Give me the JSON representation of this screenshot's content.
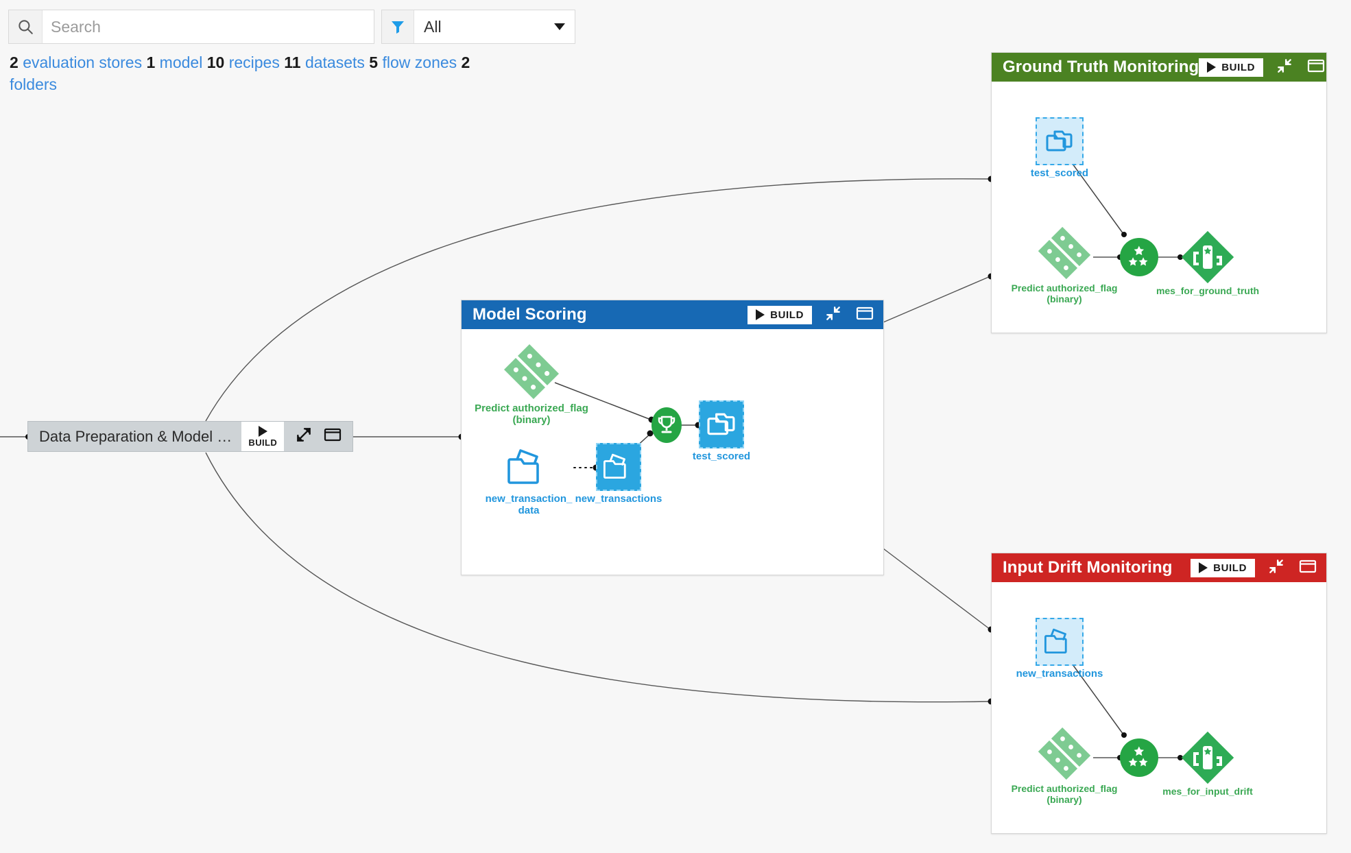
{
  "search": {
    "placeholder": "Search",
    "value": ""
  },
  "filter": {
    "value": "All",
    "icon": "filter-icon"
  },
  "summary": {
    "parts": [
      {
        "text": "2",
        "bold": true
      },
      {
        "text": "evaluation stores",
        "link": true
      },
      {
        "text": "1",
        "bold": true
      },
      {
        "text": "model",
        "link": true
      },
      {
        "text": "10",
        "bold": true
      },
      {
        "text": "recipes",
        "link": true
      },
      {
        "text": "11",
        "bold": true
      },
      {
        "text": "datasets",
        "link": true
      },
      {
        "text": "5",
        "bold": true
      },
      {
        "text": "flow zones",
        "link": true
      },
      {
        "text": "2",
        "bold": true
      },
      {
        "text": "folders",
        "link": true
      }
    ]
  },
  "zone_collapsed": {
    "name": "Data Preparation & Model …",
    "build_label": "BUILD",
    "icons": [
      "expand-icon",
      "window-icon"
    ]
  },
  "panels": [
    {
      "id": "ground-truth-monitoring",
      "title": "Ground Truth Monitoring",
      "color": "#4b8222",
      "build_label": "BUILD",
      "icons": [
        "collapse-icon",
        "window-icon"
      ],
      "nodes": [
        {
          "name": "test_scored",
          "type": "dataset-folder-managed",
          "label": "test_scored",
          "color": "#2196dd"
        },
        {
          "name": "Predict authorized_flag (binary)",
          "type": "model",
          "label": "Predict authorized_flag\n(binary)",
          "color": "#3aa853"
        },
        {
          "name": "scoring-recipe",
          "type": "recipe-stars",
          "label": "",
          "color": "#25a544"
        },
        {
          "name": "mes_for_ground_truth",
          "type": "evaluation-store",
          "label": "mes_for_ground_truth",
          "color": "#3aa853"
        }
      ]
    },
    {
      "id": "model-scoring",
      "title": "Model Scoring",
      "color": "#1769b4",
      "build_label": "BUILD",
      "icons": [
        "collapse-icon",
        "window-icon"
      ],
      "nodes": [
        {
          "name": "Predict authorized_flag (binary)",
          "type": "model",
          "label": "Predict authorized_flag\n(binary)",
          "color": "#3aa853"
        },
        {
          "name": "new_transaction_data",
          "type": "folder-outline",
          "label": "new_transaction_\ndata",
          "color": "#2196dd"
        },
        {
          "name": "new_transactions",
          "type": "dataset-uploaded",
          "label": "new_transactions",
          "color": "#2196dd"
        },
        {
          "name": "score-recipe",
          "type": "recipe-trophy",
          "label": "",
          "color": "#25a544"
        },
        {
          "name": "test_scored",
          "type": "dataset-folder-managed",
          "label": "test_scored",
          "color": "#2196dd"
        }
      ]
    },
    {
      "id": "input-drift-monitoring",
      "title": "Input Drift Monitoring",
      "color": "#ce2523",
      "build_label": "BUILD",
      "icons": [
        "collapse-icon",
        "window-icon"
      ],
      "nodes": [
        {
          "name": "new_transactions",
          "type": "dataset-uploaded-light",
          "label": "new_transactions",
          "color": "#2196dd"
        },
        {
          "name": "Predict authorized_flag (binary)",
          "type": "model",
          "label": "Predict authorized_flag\n(binary)",
          "color": "#3aa853"
        },
        {
          "name": "scoring-recipe",
          "type": "recipe-stars",
          "label": "",
          "color": "#25a544"
        },
        {
          "name": "mes_for_input_drift",
          "type": "evaluation-store",
          "label": "mes_for_input_drift",
          "color": "#3aa853"
        }
      ]
    }
  ],
  "labels": {
    "gt_test_scored": "test_scored",
    "gt_model": "Predict authorized_flag",
    "gt_model2": "(binary)",
    "gt_store": "mes_for_ground_truth",
    "ms_model": "Predict authorized_flag",
    "ms_model2": "(binary)",
    "ms_folder": "new_transaction_",
    "ms_folder2": "data",
    "ms_newtx": "new_transactions",
    "ms_test_scored": "test_scored",
    "id_newtx": "new_transactions",
    "id_model": "Predict authorized_flag",
    "id_model2": "(binary)",
    "id_store": "mes_for_input_drift"
  },
  "colors": {
    "green_header": "#4b8222",
    "blue_header": "#1769b4",
    "red_header": "#ce2523",
    "node_blue": "#2196dd",
    "node_green": "#3aa853",
    "recipe_green": "#25a544",
    "model_green": "#7ecb92",
    "background": "#f7f7f7"
  }
}
